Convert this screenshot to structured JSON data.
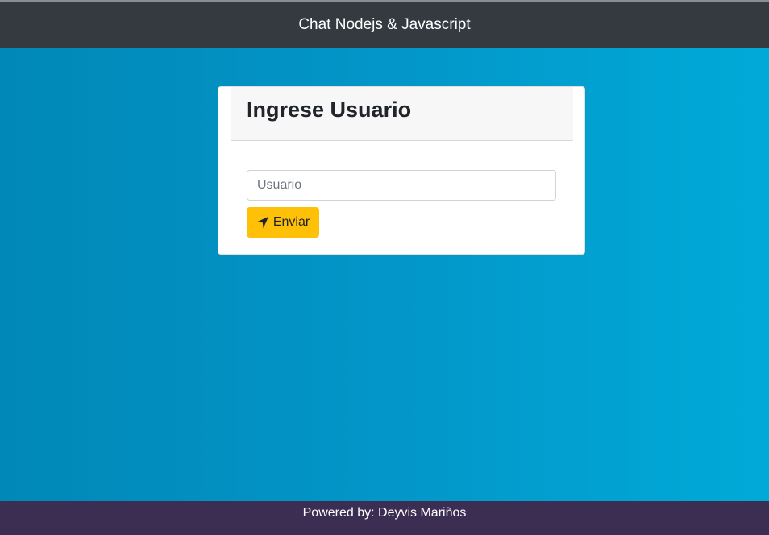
{
  "navbar": {
    "title": "Chat Nodejs & Javascript"
  },
  "login_card": {
    "heading": "Ingrese Usuario",
    "username_input": {
      "placeholder": "Usuario",
      "value": ""
    },
    "submit_button": {
      "label": "Enviar",
      "icon": "location-arrow-icon"
    }
  },
  "footer": {
    "text": "Powered by: Deyvis Mariños"
  },
  "colors": {
    "navbar_bg": "#343a40",
    "button_bg": "#ffc107",
    "footer_bg": "#3b2e52",
    "background_gradient_start": "#0088b8",
    "background_gradient_end": "#00aad8"
  }
}
